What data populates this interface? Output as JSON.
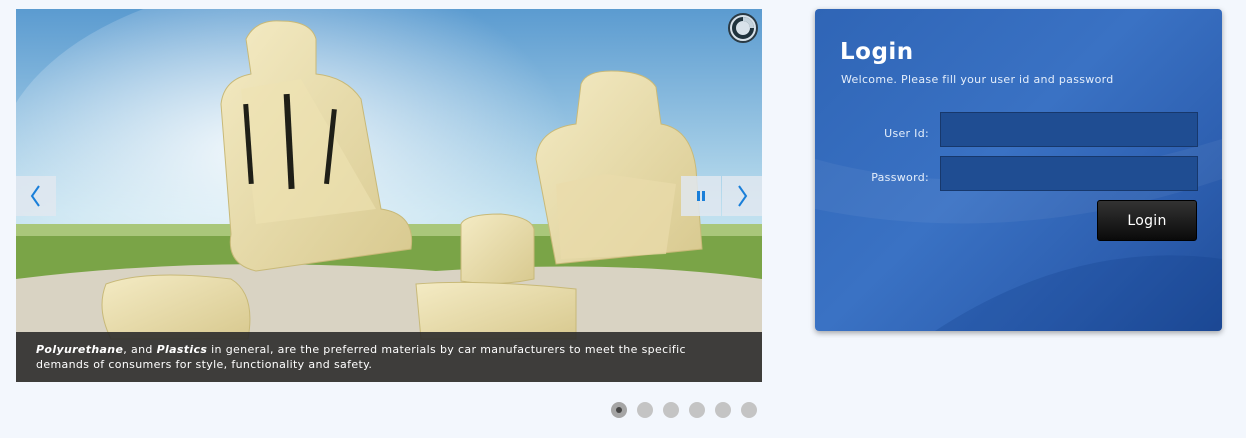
{
  "slider": {
    "caption": {
      "bold1": "Polyurethane",
      "text1": ", and ",
      "bold2": "Plastics",
      "text2": " in general, are the preferred materials by car manufacturers to meet the specific demands of consumers for style, functionality and safety."
    },
    "slide_count": 6,
    "active_slide": 1,
    "prev_icon": "chevron-left-icon",
    "next_icon": "chevron-right-icon",
    "pause_icon": "pause-icon",
    "timer_icon": "loading-timer-icon"
  },
  "login": {
    "title": "Login",
    "subtitle": "Welcome. Please fill your user id and password",
    "userid_label": "User Id:",
    "password_label": "Password:",
    "userid_value": "",
    "password_value": "",
    "button_label": "Login"
  },
  "colors": {
    "page_bg": "#f3f7fd",
    "panel_blue": "#3a72c4",
    "input_blue": "#1f4d92",
    "accent_arrow": "#1a7fd9"
  }
}
